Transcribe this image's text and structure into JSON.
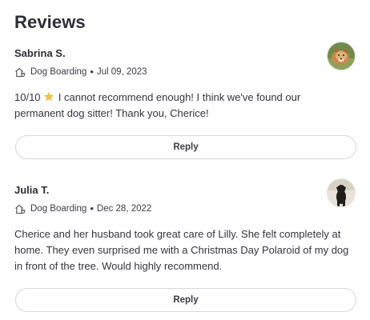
{
  "section": {
    "title": "Reviews"
  },
  "reviews": [
    {
      "name": "Sabrina S.",
      "service": "Dog Boarding",
      "date": "Jul 09, 2023",
      "text_before_star": "10/10",
      "star": "⭐",
      "text_after_star": "I cannot recommend enough! I think we've found our permanent dog sitter! Thank you, Cherice!",
      "reply_label": "Reply"
    },
    {
      "name": "Julia T.",
      "service": "Dog Boarding",
      "date": "Dec 28, 2022",
      "text": "Cherice and her husband took great care of Lilly. She felt completely at home. They even surprised me with a Christmas Day Polaroid of my dog in front of the tree. Would highly recommend.",
      "reply_label": "Reply"
    }
  ],
  "separator": "•",
  "icons": {
    "service": "dog-boarding-icon",
    "rating": "star-icon"
  },
  "colors": {
    "text_primary": "#2d2d36",
    "text_secondary": "#3d3d46",
    "button_border": "#d7d7dc",
    "star": "#f5c542"
  }
}
